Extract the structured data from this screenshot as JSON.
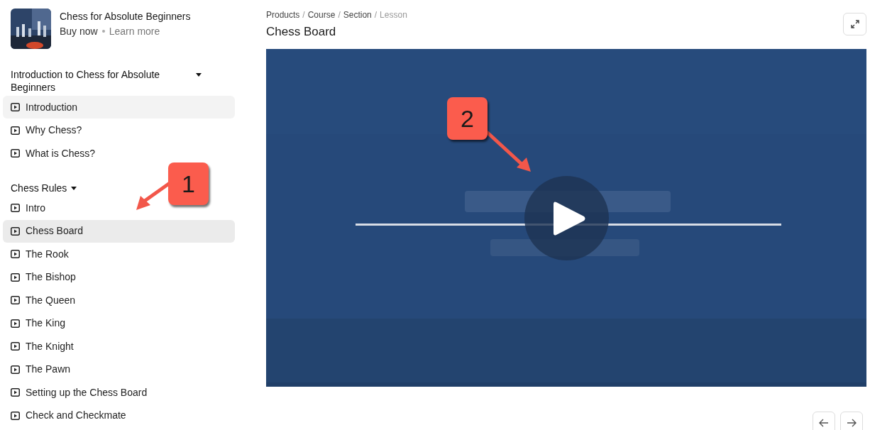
{
  "course": {
    "title": "Chess for Absolute Beginners",
    "links": [
      "Buy now",
      "Learn more"
    ]
  },
  "sections": [
    {
      "title": "Introduction to Chess for Absolute Beginners",
      "expanded": true,
      "lessons": [
        {
          "label": "Introduction",
          "selected": false,
          "hovered": true
        },
        {
          "label": "Why Chess?",
          "selected": false,
          "hovered": false
        },
        {
          "label": "What is Chess?",
          "selected": false,
          "hovered": false
        }
      ]
    },
    {
      "title": "Chess Rules",
      "expanded": true,
      "lessons": [
        {
          "label": "Intro",
          "selected": false,
          "hovered": false
        },
        {
          "label": "Chess Board",
          "selected": true,
          "hovered": false
        },
        {
          "label": "The Rook",
          "selected": false,
          "hovered": false
        },
        {
          "label": "The Bishop",
          "selected": false,
          "hovered": false
        },
        {
          "label": "The Queen",
          "selected": false,
          "hovered": false
        },
        {
          "label": "The King",
          "selected": false,
          "hovered": false
        },
        {
          "label": "The Knight",
          "selected": false,
          "hovered": false
        },
        {
          "label": "The Pawn",
          "selected": false,
          "hovered": false
        },
        {
          "label": "Setting up the Chess Board",
          "selected": false,
          "hovered": false
        },
        {
          "label": "Check and Checkmate",
          "selected": false,
          "hovered": false
        }
      ]
    }
  ],
  "breadcrumb": [
    {
      "label": "Products",
      "current": false
    },
    {
      "label": "Course",
      "current": false
    },
    {
      "label": "Section",
      "current": false
    },
    {
      "label": "Lesson",
      "current": true
    }
  ],
  "breadcrumb_separator": "/",
  "lesson_title": "Chess Board",
  "annotations": [
    "1",
    "2"
  ]
}
